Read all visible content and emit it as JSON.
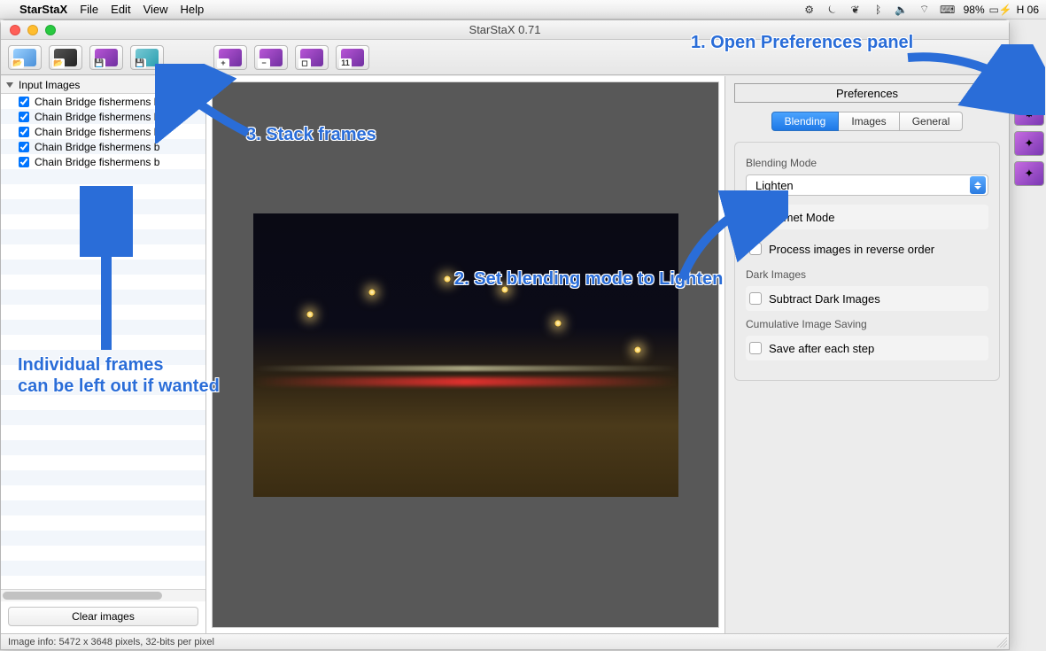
{
  "menubar": {
    "app": "StarStaX",
    "items": [
      "File",
      "Edit",
      "View",
      "Help"
    ],
    "battery": "98%",
    "clock": "H 06"
  },
  "window": {
    "title": "StarStaX 0.71"
  },
  "toolbar": {
    "btn_open": "open",
    "btn_open_dark": "open-dark",
    "btn_save": "save",
    "btn_save_all": "save-all",
    "btn_add": "+",
    "btn_remove": "−",
    "btn_crop": "◻",
    "btn_number": "11"
  },
  "left": {
    "header": "Input Images",
    "files": [
      "Chain Bridge fishermens b",
      "Chain Bridge fishermens b",
      "Chain Bridge fishermens b",
      "Chain Bridge fishermens b",
      "Chain Bridge fishermens b"
    ],
    "clear": "Clear images"
  },
  "prefs": {
    "title": "Preferences",
    "tabs": {
      "blending": "Blending",
      "images": "Images",
      "general": "General"
    },
    "blending_mode_label": "Blending Mode",
    "blending_mode_value": "Lighten",
    "comet": "Comet Mode",
    "reverse": "Process images in reverse order",
    "dark_label": "Dark Images",
    "subtract": "Subtract Dark Images",
    "cumulative_label": "Cumulative Image Saving",
    "save_each": "Save after each step"
  },
  "status": {
    "text": "Image info: 5472 x 3648 pixels, 32-bits per pixel"
  },
  "annotations": {
    "a1": "1. Open Preferences panel",
    "a2": "2. Set blending mode to Lighten",
    "a3": "3. Stack frames",
    "a4": "Individual frames\ncan be left out if wanted"
  }
}
